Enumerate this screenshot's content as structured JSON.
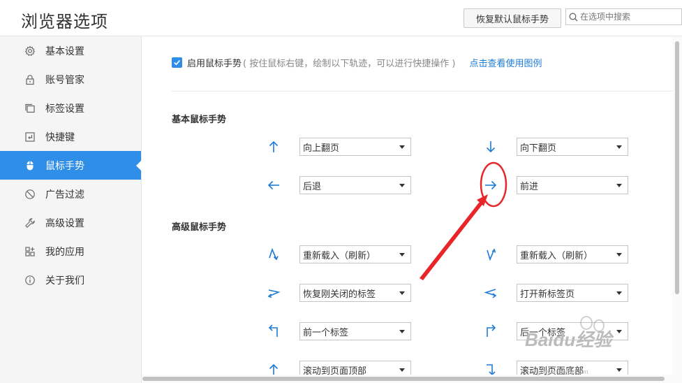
{
  "header": {
    "title": "浏览器选项",
    "restore_button": "恢复默认鼠标手势",
    "search_placeholder": "在选项中搜索"
  },
  "sidebar": {
    "items": [
      {
        "label": "基本设置",
        "icon": "gear-icon"
      },
      {
        "label": "账号管家",
        "icon": "lock-icon"
      },
      {
        "label": "标签设置",
        "icon": "tabs-icon"
      },
      {
        "label": "快捷键",
        "icon": "keyboard-icon"
      },
      {
        "label": "鼠标手势",
        "icon": "mouse-icon",
        "active": true
      },
      {
        "label": "广告过滤",
        "icon": "block-icon"
      },
      {
        "label": "高级设置",
        "icon": "wrench-icon"
      },
      {
        "label": "我的应用",
        "icon": "apps-icon"
      },
      {
        "label": "关于我们",
        "icon": "info-icon"
      }
    ]
  },
  "main": {
    "enable_label": "启用鼠标手势",
    "enable_hint": "( 按住鼠标右键，绘制以下轨迹，可以进行快捷操作 )",
    "enable_checked": true,
    "help_link": "点击查看使用图例",
    "basic_title": "基本鼠标手势",
    "advanced_title": "高级鼠标手势",
    "basic": [
      {
        "icon": "arrow-up-icon",
        "value": "向上翻页"
      },
      {
        "icon": "arrow-down-icon",
        "value": "向下翻页"
      },
      {
        "icon": "arrow-left-icon",
        "value": "后退"
      },
      {
        "icon": "arrow-right-icon",
        "value": "前进"
      }
    ],
    "advanced": [
      {
        "icon": "gesture-up-down-icon",
        "value": "重新载入（刷新）"
      },
      {
        "icon": "gesture-down-up-icon",
        "value": "重新载入（刷新）"
      },
      {
        "icon": "gesture-right-left-icon",
        "value": "恢复刚关闭的标签"
      },
      {
        "icon": "gesture-left-right-icon",
        "value": "打开新标签页"
      },
      {
        "icon": "gesture-up-left-icon",
        "value": "前一个标签"
      },
      {
        "icon": "gesture-up-right-icon",
        "value": "后一个标签"
      },
      {
        "icon": "gesture-left-up-icon",
        "value": "滚动到页面顶部"
      },
      {
        "icon": "gesture-right-down-icon",
        "value": "滚动到页面底部"
      }
    ]
  },
  "colors": {
    "accent": "#2f8ee8",
    "annotation": "#e8262a"
  },
  "watermark": {
    "text": "Baidu经验",
    "sub": "jingyan.baidu.com"
  }
}
